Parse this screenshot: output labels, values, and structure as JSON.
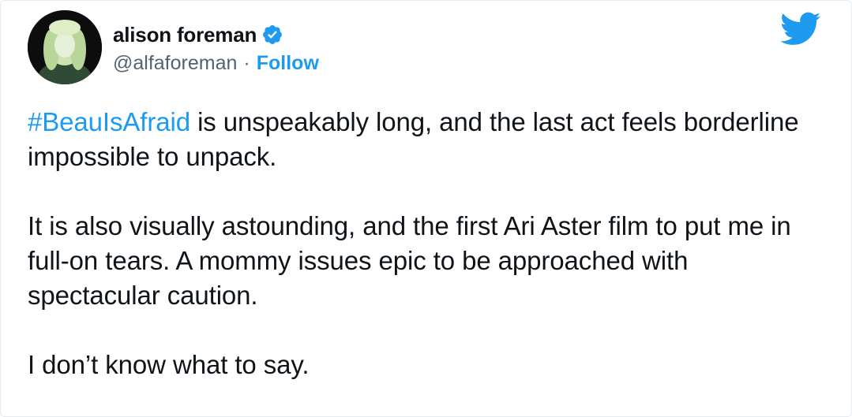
{
  "tweet": {
    "author": {
      "display_name": "alison foreman",
      "handle": "@alfaforeman",
      "separator": "·",
      "follow_label": "Follow",
      "verified": true
    },
    "hashtag": "#BeauIsAfraid",
    "paragraphs": [
      " is unspeakably long, and the last act feels borderline impossible to unpack.",
      "It is also visually astounding, and the first Ari Aster film to put me in full-on tears. A mommy issues epic to be approached with spectacular caution.",
      "I don’t know what to say."
    ],
    "icons": {
      "brand": "twitter-bird-icon",
      "badge": "verified-badge-icon"
    },
    "colors": {
      "link": "#1d9bf0",
      "text": "#0f1419",
      "muted": "#536471",
      "badge": "#1d9bf0"
    }
  }
}
